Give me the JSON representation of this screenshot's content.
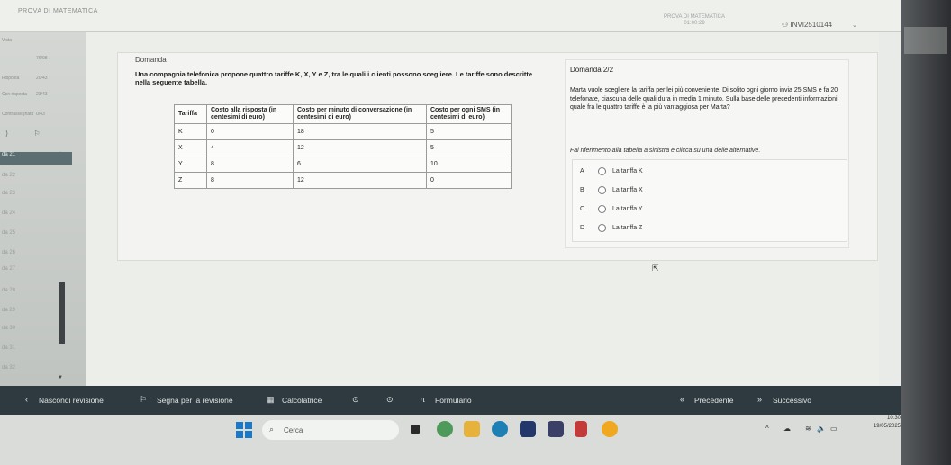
{
  "header": {
    "app_title": "PROVA DI MATEMATICA",
    "exam_name": "PROVA DI MATEMATICA",
    "timer": "01:00:29",
    "user_id": "INVI2510144"
  },
  "sidebar": {
    "rows": [
      {
        "label": "Vista",
        "value": "76/98"
      },
      {
        "label": "Risposta",
        "value": "20/43"
      },
      {
        "label": "Con risposta",
        "value": "23/43"
      },
      {
        "label": "Contrassegnato",
        "value": "0/43"
      }
    ],
    "questions": [
      "da 21",
      "da 22",
      "da 23",
      "da 24",
      "da 25",
      "da 26",
      "da 27",
      "da 28",
      "da 29",
      "da 30",
      "da 31",
      "da 32"
    ],
    "active_index": 0
  },
  "question": {
    "label": "Domanda",
    "intro": "Una compagnia telefonica propone quattro tariffe K, X, Y e Z, tra le quali i clienti possono scegliere. Le tariffe sono descritte nella seguente tabella.",
    "table": {
      "headers": [
        "Tariffa",
        "Costo alla risposta (in centesimi di euro)",
        "Costo per minuto di conversazione (in centesimi di euro)",
        "Costo per ogni SMS (in centesimi di euro)"
      ],
      "rows": [
        [
          "K",
          "0",
          "18",
          "5"
        ],
        [
          "X",
          "4",
          "12",
          "5"
        ],
        [
          "Y",
          "8",
          "6",
          "10"
        ],
        [
          "Z",
          "8",
          "12",
          "0"
        ]
      ]
    }
  },
  "sub_question": {
    "title": "Domanda 2/2",
    "text": "Marta vuole scegliere la tariffa per lei più conveniente. Di solito ogni giorno invia 25 SMS e fa 20 telefonate, ciascuna delle quali dura in media 1 minuto. Sulla base delle precedenti informazioni, quale fra le quattro tariffe è la più vantaggiosa per Marta?",
    "hint": "Fai riferimento alla tabella a sinistra e clicca su una delle alternative.",
    "options": [
      {
        "letter": "A",
        "text": "La tariffa K"
      },
      {
        "letter": "B",
        "text": "La tariffa X"
      },
      {
        "letter": "C",
        "text": "La tariffa Y"
      },
      {
        "letter": "D",
        "text": "La tariffa Z"
      }
    ]
  },
  "bottombar": {
    "review_label": "Nascondi revisione",
    "flag_label": "Segna per la revisione",
    "calculator_label": "Calcolatrice",
    "formulary_label": "Formulario",
    "prev_label": "Precedente",
    "next_label": "Successivo"
  },
  "taskbar": {
    "search_placeholder": "Cerca",
    "time": "10:30",
    "date": "19/05/2025"
  },
  "colors": {
    "bottombar": "#2f3a40",
    "active_question": "#5b6f72",
    "windows_blue": "#1b78c6"
  }
}
